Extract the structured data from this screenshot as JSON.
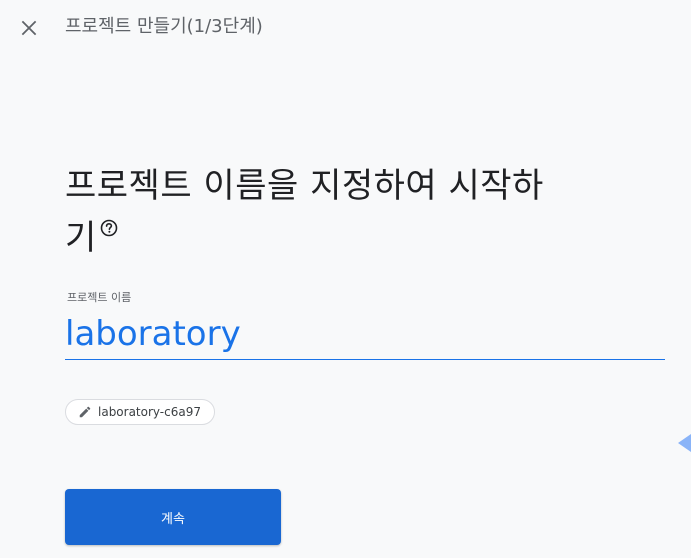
{
  "header": {
    "close_icon": "close-icon",
    "title": "프로젝트 만들기(1/3단계)"
  },
  "main": {
    "heading_line1": "프로젝트 이름을 지정하여 시작하",
    "heading_line2": "기",
    "help_icon": "help-circle-icon",
    "field_label": "프로젝트 이름",
    "project_name_value": "laboratory",
    "project_id_chip": {
      "icon": "pencil-icon",
      "text": "laboratory-c6a97"
    },
    "continue_label": "계속"
  },
  "colors": {
    "accent": "#1a73e8",
    "button": "#1967d2",
    "background": "#f8f9fa"
  }
}
